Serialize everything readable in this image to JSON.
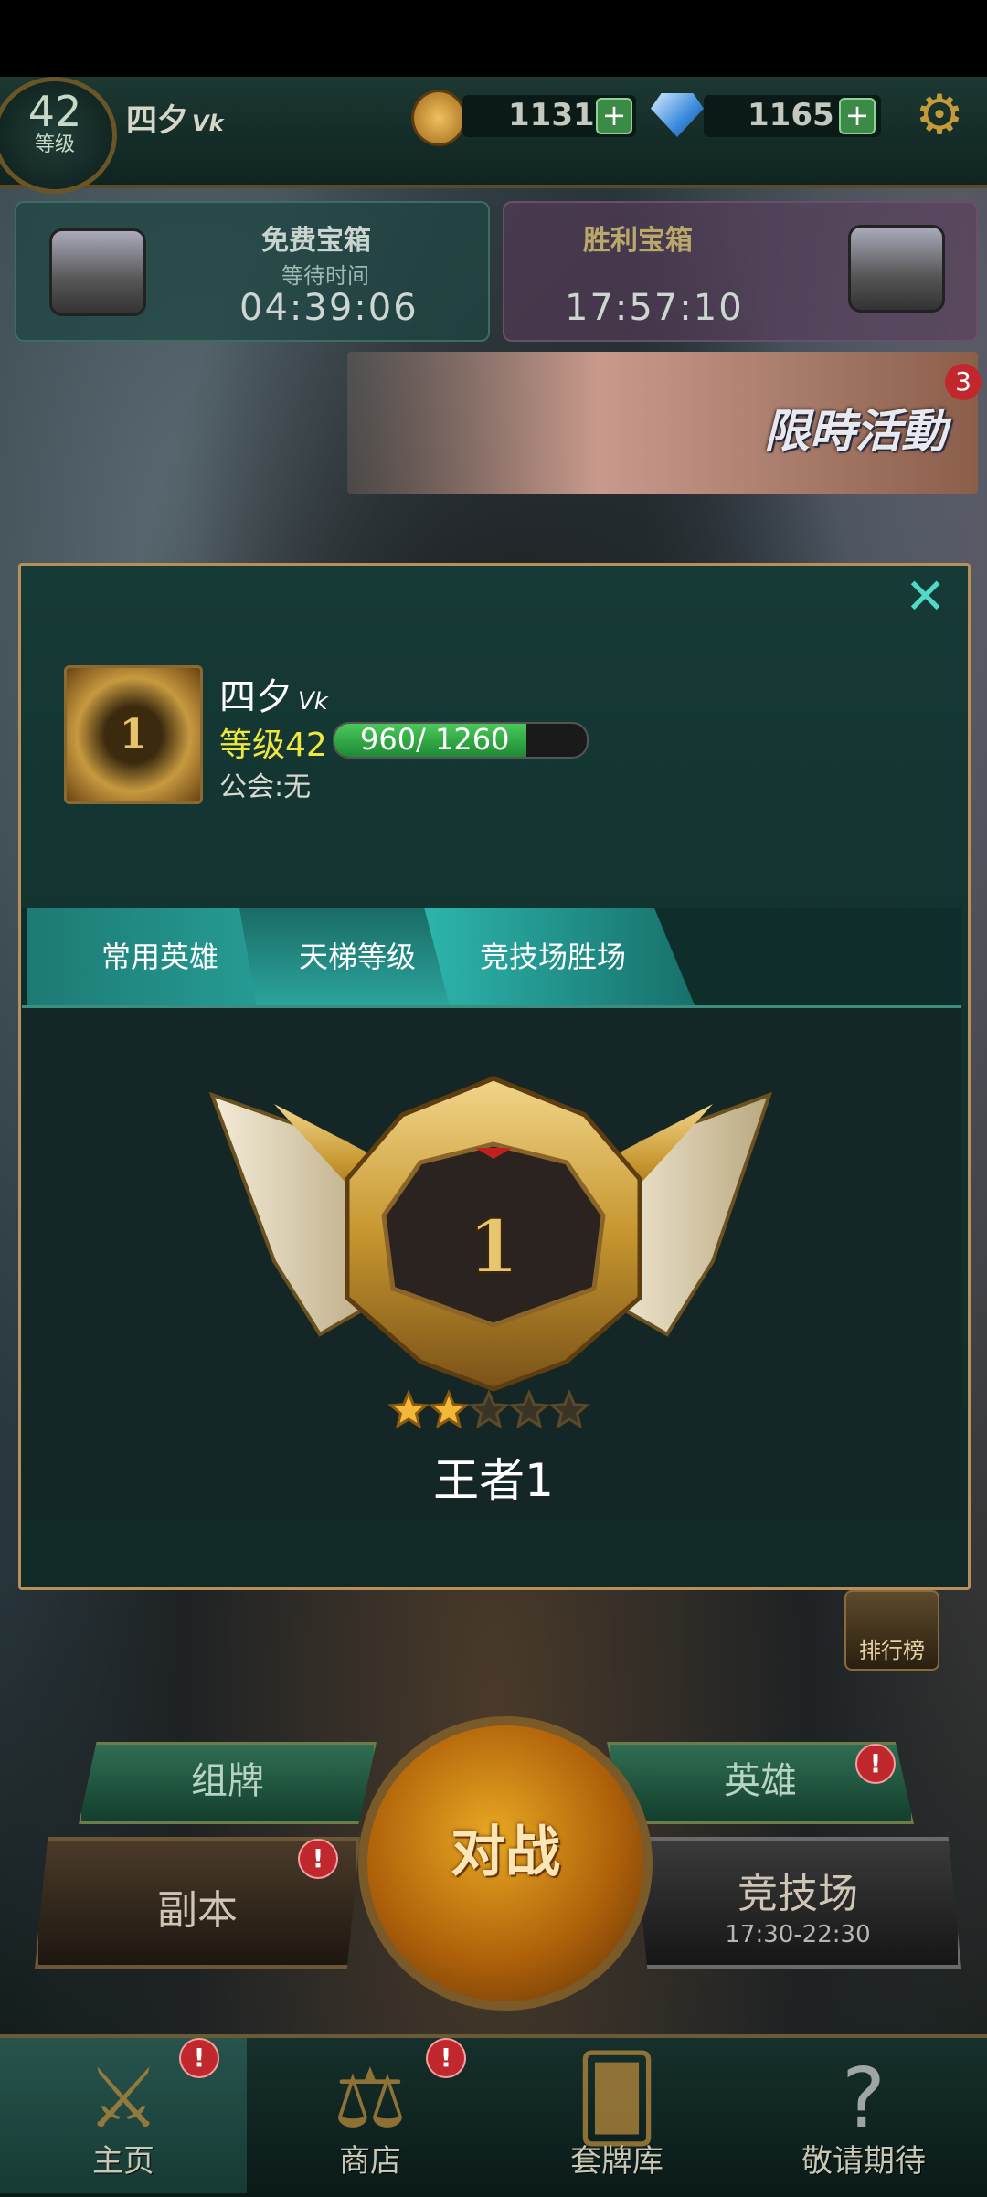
{
  "header": {
    "level_value": "42",
    "level_label": "等级",
    "player_name": "四夕",
    "player_name_badge": "ᐯk",
    "gold": "1131",
    "gems": "1165",
    "plus": "+"
  },
  "chests": {
    "free": {
      "title": "免费宝箱",
      "subtitle": "等待时间",
      "timer": "04:39:06"
    },
    "victory": {
      "title": "胜利宝箱",
      "timer": "17:57:10"
    }
  },
  "event": {
    "label": "限時活動",
    "count": "3"
  },
  "profile": {
    "close": "✕",
    "avatar_rank": "1",
    "name": "四夕",
    "name_badge": "ᐯk",
    "level_text": "等级42",
    "exp_current": 960,
    "exp_max": 1260,
    "exp_text": "960/ 1260",
    "guild": "公会:无",
    "tabs": [
      {
        "label": "常用英雄"
      },
      {
        "label": "天梯等级"
      },
      {
        "label": "竞技场胜场"
      }
    ],
    "active_tab": 1,
    "rank_number": "1",
    "stars_filled": 2,
    "stars_total": 5,
    "rank_name": "王者1"
  },
  "lobby": {
    "leaderboard": "排行榜",
    "deck_button": "组牌",
    "hero_button": "英雄",
    "dungeon_button": "副本",
    "arena_button": "竞技场",
    "arena_hours": "17:30-22:30",
    "battle_button": "对战",
    "alert": "!"
  },
  "nav": [
    {
      "label": "主页",
      "icon": "crossed-swords-icon",
      "alert": true
    },
    {
      "label": "商店",
      "icon": "scales-icon",
      "alert": true
    },
    {
      "label": "套牌库",
      "icon": "cards-icon",
      "alert": false
    },
    {
      "label": "敬请期待",
      "icon": "question-icon",
      "alert": false
    }
  ],
  "colors": {
    "accent_teal": "#2cb4ab",
    "level_yellow": "#f0e640",
    "exp_green": "#4ac85a",
    "gold_trim": "#c99a3a",
    "alert_red": "#c0282d"
  }
}
